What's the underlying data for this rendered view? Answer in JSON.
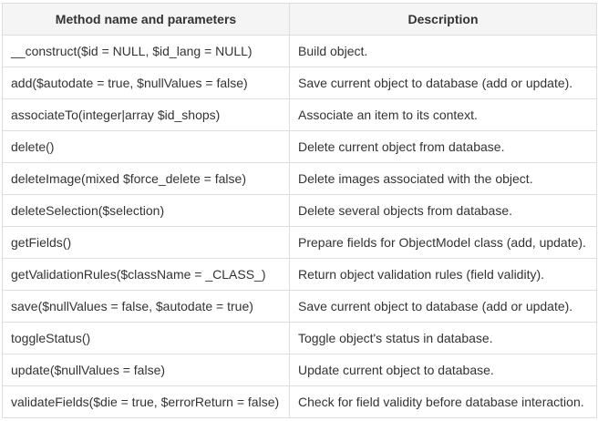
{
  "table": {
    "headers": [
      "Method name and parameters",
      "Description"
    ],
    "rows": [
      {
        "method": "__construct($id = NULL, $id_lang = NULL)",
        "description": "Build object."
      },
      {
        "method": "add($autodate = true, $nullValues = false)",
        "description": "Save current object to database (add or update)."
      },
      {
        "method": "associateTo(integer|array $id_shops)",
        "description": "Associate an item to its context."
      },
      {
        "method": "delete()",
        "description": "Delete current object from database."
      },
      {
        "method": "deleteImage(mixed $force_delete = false)",
        "description": "Delete images associated with the object."
      },
      {
        "method": "deleteSelection($selection)",
        "description": "Delete several objects from database."
      },
      {
        "method": "getFields()",
        "description": "Prepare fields for ObjectModel class (add, update)."
      },
      {
        "method": "getValidationRules($className = _CLASS_)",
        "description": "Return object validation rules (field validity)."
      },
      {
        "method": "save($nullValues = false, $autodate = true)",
        "description": "Save current object to database (add or update)."
      },
      {
        "method": "toggleStatus()",
        "description": "Toggle object's status in database."
      },
      {
        "method": "update($nullValues = false)",
        "description": "Update current object to database."
      },
      {
        "method": "validateFields($die = true, $errorReturn = false)",
        "description": "Check for field validity before database interaction."
      }
    ]
  }
}
